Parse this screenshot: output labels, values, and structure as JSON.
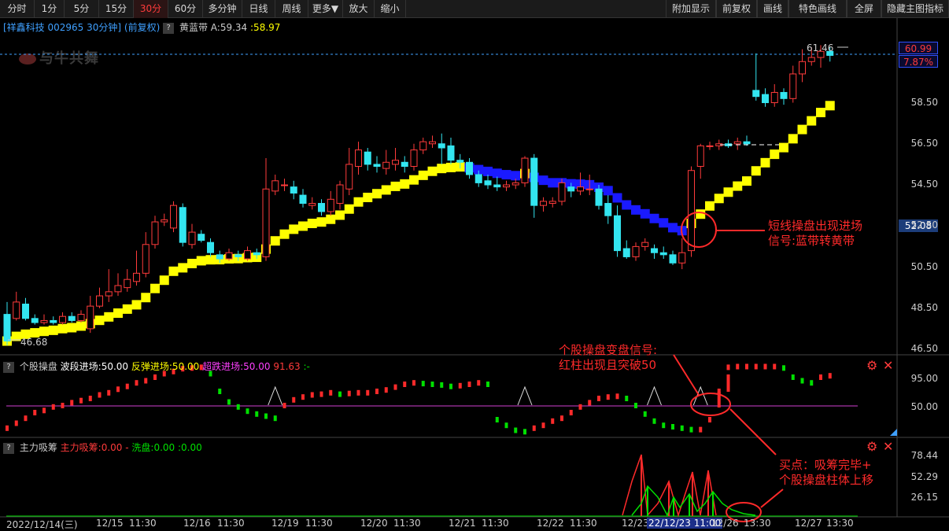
{
  "toolbar": {
    "left": [
      "分时",
      "1分",
      "5分",
      "15分",
      "30分",
      "60分",
      "多分钟",
      "日线",
      "周线",
      "更多▼",
      "放大",
      "缩小"
    ],
    "right": [
      "附加显示",
      "前复权",
      "画线",
      "特色画线",
      "全屏",
      "隐藏主图指标"
    ],
    "active": "30分"
  },
  "main_panel": {
    "stock_label": "[祥鑫科技 002965 30分钟]",
    "adjust_label": "(前复权)",
    "indicator_name": "黄蓝带",
    "indicator_a_label": "A:59.34",
    "indicator_b_label": ":58.97",
    "watermark": "与牛共舞",
    "high_marker": "61.46",
    "low_marker": "46.68",
    "current_price": "60.99",
    "change_pct": "7.87%",
    "hover_price": "52.08",
    "price_axis": [
      "58.50",
      "56.50",
      "54.50",
      "52.50",
      "50.50",
      "48.50",
      "46.50"
    ]
  },
  "sub_panel_1": {
    "name": "个股操盘",
    "legend": [
      {
        "text": "波段进场:50.00",
        "color": "#ffffff"
      },
      {
        "text": "反弹进场:50.00",
        "color": "#ffff00"
      },
      {
        "text": "超跌进场:50.00",
        "color": "#ff40ff"
      },
      {
        "text": "91.63",
        "color": "#ff3b3b"
      },
      {
        "text": ":-",
        "color": "#00e000"
      }
    ],
    "axis": [
      "95.00",
      "50.00"
    ]
  },
  "sub_panel_2": {
    "name": "主力吸筹",
    "legend": [
      {
        "text": "主力吸筹:0.00",
        "color": "#ff3b3b"
      },
      {
        "text": "-",
        "color": "#ff3b3b"
      },
      {
        "text": "洗盘:0.00",
        "color": "#00e000"
      },
      {
        "text": ":0.00",
        "color": "#00e000"
      }
    ],
    "axis": [
      "78.44",
      "52.29",
      "26.15"
    ]
  },
  "time_axis": [
    "2022/12/14(三)",
    "12/15",
    "11:30",
    "12/16",
    "11:30",
    "12/19",
    "11:30",
    "12/20",
    "11:30",
    "12/21",
    "11:30",
    "12/22",
    "11:30",
    "12/23",
    "22/12/23 11:00",
    "12/26",
    "13:30",
    "12/27",
    "13:30"
  ],
  "annotations": {
    "a1_line1": "短线操盘出现进场",
    "a1_line2": "信号:蓝带转黄带",
    "a2_line1": "个股操盘变盘信号:",
    "a2_line2": "红柱出现且突破50",
    "a3_line1": "买点：吸筹完毕+",
    "a3_line2": "个股操盘柱体上移"
  },
  "colors": {
    "up": "#ff3b3b",
    "down": "#33e5f0",
    "band_up": "#ffff00",
    "band_down": "#1a1aff",
    "accent": "#ff2a2a"
  },
  "chart_data": {
    "type": "candlestick",
    "ylim": [
      46.5,
      61.2
    ],
    "candles": [
      [
        48.2,
        46.9,
        48.8,
        46.7
      ],
      [
        48.0,
        48.8,
        49.3,
        47.9
      ],
      [
        48.7,
        48.0,
        49.0,
        47.9
      ],
      [
        48.0,
        47.8,
        48.2,
        47.7
      ],
      [
        47.8,
        47.9,
        48.2,
        47.7
      ],
      [
        47.9,
        47.8,
        48.1,
        47.7
      ],
      [
        47.8,
        48.1,
        48.3,
        47.7
      ],
      [
        48.1,
        47.9,
        48.3,
        47.8
      ],
      [
        47.9,
        48.2,
        48.4,
        47.8
      ],
      [
        47.5,
        48.6,
        49.1,
        47.3
      ],
      [
        48.6,
        49.1,
        49.5,
        48.5
      ],
      [
        49.1,
        49.3,
        50.4,
        48.8
      ],
      [
        49.3,
        49.6,
        50.2,
        49.1
      ],
      [
        49.5,
        49.9,
        50.4,
        49.3
      ],
      [
        49.8,
        50.2,
        51.3,
        49.6
      ],
      [
        50.2,
        51.6,
        52.2,
        50.0
      ],
      [
        51.6,
        52.7,
        53.0,
        51.4
      ],
      [
        52.7,
        52.8,
        53.1,
        52.5
      ],
      [
        52.4,
        53.5,
        53.7,
        52.2
      ],
      [
        53.4,
        51.7,
        53.6,
        51.5
      ],
      [
        51.6,
        52.2,
        52.6,
        51.4
      ],
      [
        52.1,
        51.8,
        52.3,
        51.7
      ],
      [
        51.7,
        51.2,
        51.9,
        51.0
      ],
      [
        51.1,
        50.9,
        51.3,
        50.7
      ],
      [
        50.9,
        51.2,
        51.4,
        50.8
      ],
      [
        51.1,
        51.0,
        51.3,
        50.8
      ],
      [
        50.9,
        51.3,
        51.5,
        50.8
      ],
      [
        51.2,
        51.1,
        51.4,
        50.9
      ],
      [
        51.0,
        54.3,
        55.8,
        50.8
      ],
      [
        54.2,
        54.7,
        55.0,
        54.0
      ],
      [
        54.5,
        54.5,
        54.8,
        54.2
      ],
      [
        54.4,
        54.1,
        54.7,
        53.8
      ],
      [
        54.0,
        53.6,
        54.3,
        53.4
      ],
      [
        53.5,
        53.6,
        53.9,
        53.3
      ],
      [
        53.6,
        53.2,
        53.8,
        53.0
      ],
      [
        53.2,
        53.8,
        54.2,
        53.0
      ],
      [
        53.6,
        54.5,
        54.7,
        53.3
      ],
      [
        54.3,
        55.5,
        56.3,
        54.0
      ],
      [
        55.4,
        56.2,
        56.6,
        55.0
      ],
      [
        56.1,
        55.5,
        56.3,
        55.2
      ],
      [
        55.5,
        55.4,
        55.9,
        55.1
      ],
      [
        55.3,
        55.6,
        56.2,
        55.0
      ],
      [
        55.5,
        55.7,
        56.3,
        55.2
      ],
      [
        55.6,
        55.4,
        55.9,
        55.1
      ],
      [
        55.4,
        56.2,
        56.5,
        55.2
      ],
      [
        56.2,
        56.6,
        56.8,
        56.0
      ],
      [
        56.5,
        56.6,
        56.9,
        56.3
      ],
      [
        56.5,
        56.3,
        57.0,
        55.5
      ],
      [
        56.4,
        55.7,
        56.8,
        55.5
      ],
      [
        55.7,
        55.6,
        56.0,
        55.3
      ],
      [
        55.6,
        55.0,
        55.8,
        54.8
      ],
      [
        55.0,
        54.6,
        55.2,
        54.4
      ],
      [
        54.7,
        54.5,
        55.0,
        54.3
      ],
      [
        54.5,
        54.4,
        54.9,
        54.2
      ],
      [
        54.4,
        54.5,
        54.7,
        54.2
      ],
      [
        54.5,
        54.6,
        54.8,
        54.3
      ],
      [
        54.6,
        55.8,
        55.9,
        54.4
      ],
      [
        55.8,
        53.5,
        56.0,
        52.9
      ],
      [
        53.5,
        53.7,
        53.9,
        53.2
      ],
      [
        53.6,
        53.7,
        53.9,
        53.4
      ],
      [
        53.7,
        54.6,
        54.8,
        53.5
      ],
      [
        54.4,
        54.2,
        54.6,
        53.9
      ],
      [
        54.2,
        54.4,
        55.1,
        54.0
      ],
      [
        54.3,
        54.3,
        55.0,
        54.0
      ],
      [
        54.3,
        53.5,
        54.5,
        53.3
      ],
      [
        53.6,
        53.0,
        54.0,
        52.6
      ],
      [
        53.0,
        51.3,
        53.5,
        51.0
      ],
      [
        51.4,
        51.0,
        51.8,
        50.9
      ],
      [
        51.0,
        51.5,
        51.7,
        50.8
      ],
      [
        51.5,
        51.7,
        51.9,
        51.3
      ],
      [
        51.4,
        51.2,
        51.6,
        50.9
      ],
      [
        51.2,
        51.1,
        51.5,
        50.9
      ],
      [
        51.1,
        50.7,
        51.3,
        50.6
      ],
      [
        50.7,
        51.2,
        51.9,
        50.4
      ],
      [
        51.3,
        55.2,
        55.4,
        51.0
      ],
      [
        55.4,
        56.4,
        56.5,
        54.8
      ],
      [
        56.4,
        56.4,
        56.6,
        56.2
      ],
      [
        56.4,
        56.5,
        56.7,
        56.2
      ],
      [
        56.5,
        56.4,
        56.7,
        56.3
      ],
      [
        56.5,
        56.6,
        56.8,
        56.2
      ],
      [
        56.6,
        56.5,
        56.9,
        56.4
      ],
      [
        59.1,
        58.8,
        60.9,
        58.6
      ],
      [
        58.9,
        58.5,
        59.2,
        58.3
      ],
      [
        58.5,
        59.0,
        59.4,
        58.3
      ],
      [
        59.0,
        58.7,
        59.2,
        58.4
      ],
      [
        58.7,
        59.9,
        60.3,
        58.5
      ],
      [
        59.9,
        60.5,
        61.1,
        59.5
      ],
      [
        60.5,
        60.7,
        61.2,
        60.3
      ],
      [
        60.7,
        61.0,
        61.3,
        60.2
      ],
      [
        61.0,
        60.8,
        61.2,
        60.5
      ]
    ]
  }
}
